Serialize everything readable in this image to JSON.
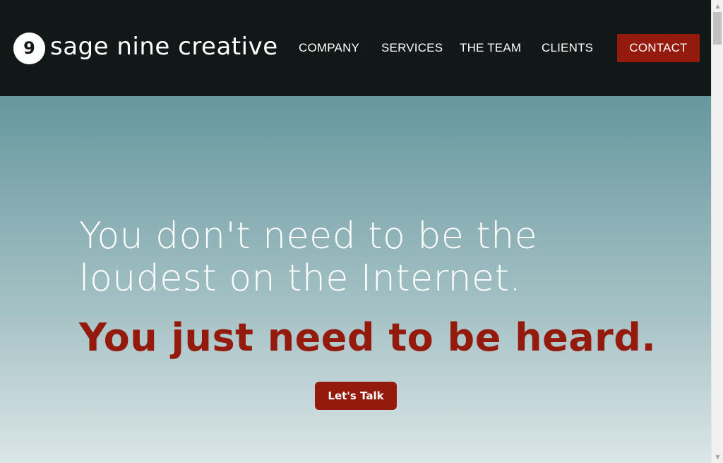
{
  "brand": {
    "badge": "9",
    "name": "sage nine creative"
  },
  "nav": {
    "items": [
      {
        "label": "COMPANY"
      },
      {
        "label": "SERVICES"
      },
      {
        "label": "THE TEAM"
      },
      {
        "label": "CLIENTS"
      }
    ],
    "contact_label": "CONTACT"
  },
  "hero": {
    "headline": "You don't need to be the loudest on the Internet.",
    "tagline": "You just need to be heard.",
    "cta_label": "Let's Talk"
  },
  "colors": {
    "header_bg": "#121817",
    "accent": "#941a0d",
    "hero_top": "#66979f",
    "hero_bottom": "#dbe6e7"
  },
  "icons": {
    "scroll_up": "triangle-up-icon",
    "scroll_down": "triangle-down-icon"
  }
}
